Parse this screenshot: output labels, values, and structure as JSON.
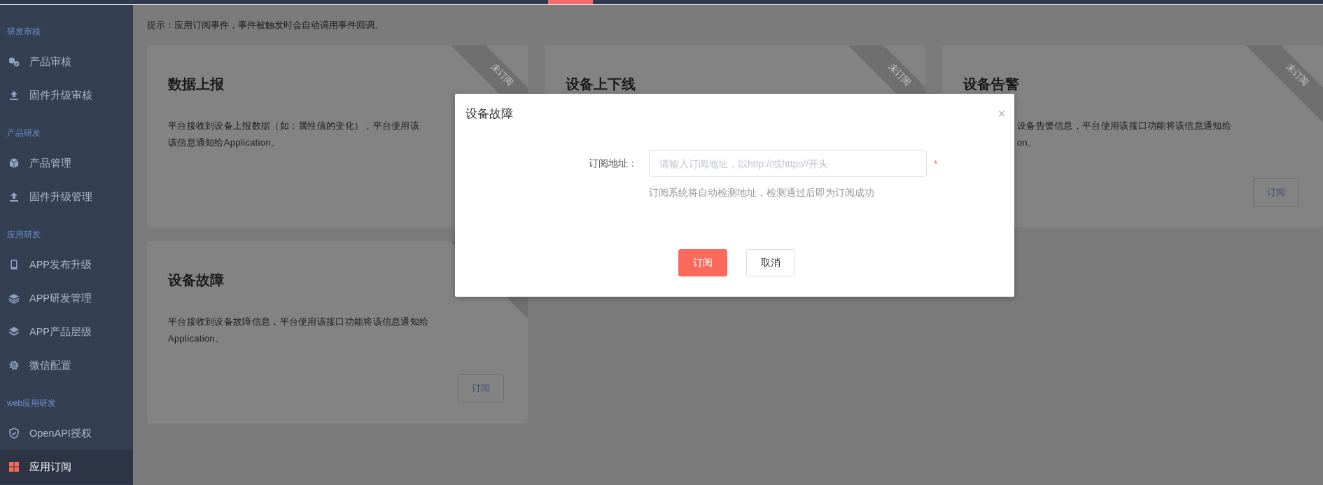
{
  "sidebar": {
    "sections": [
      {
        "label": "研发审核",
        "items": [
          {
            "label": "产品审核",
            "selected": false
          },
          {
            "label": "固件升级审核",
            "selected": false
          }
        ]
      },
      {
        "label": "产品研发",
        "items": [
          {
            "label": "产品管理",
            "selected": false
          },
          {
            "label": "固件升级管理",
            "selected": false
          }
        ]
      },
      {
        "label": "应用研发",
        "items": [
          {
            "label": "APP发布升级",
            "selected": false
          },
          {
            "label": "APP研发管理",
            "selected": false
          },
          {
            "label": "APP产品层级",
            "selected": false
          },
          {
            "label": "微信配置",
            "selected": false
          }
        ]
      },
      {
        "label": "web应用研发",
        "items": [
          {
            "label": "OpenAPI授权",
            "selected": false
          },
          {
            "label": "应用订阅",
            "selected": true
          }
        ]
      }
    ]
  },
  "hint": "提示：应用订阅事件，事件被触发时会自动调用事件回调。",
  "cards": [
    {
      "title": "数据上报",
      "ribbon_label": "未订阅",
      "lines": [
        "平台接收到设备上报数据（如：属性值的变化），平台使用该",
        "该信息通知给Application。"
      ]
    },
    {
      "title": "设备上下线",
      "ribbon_label": "未订阅"
    },
    {
      "title": "设备告警",
      "ribbon_label": "未订阅",
      "clipped_left": true,
      "lines": [
        "设备告警信息，平台使用该接口功能将该信息通知给",
        "on。"
      ],
      "button": "订阅"
    },
    {
      "title": "设备故障",
      "lines": [
        "平台接收到设备故障信息，平台使用该接口功能将该信息通知给",
        "Application。"
      ],
      "button": "订阅"
    }
  ],
  "modal": {
    "title": "设备故障",
    "close": "×",
    "field_label": "订阅地址：",
    "placeholder": "请输入订阅地址，以http://或https//开头",
    "required_mark": "*",
    "field_hint": "订阅系统将自动检测地址，检测通过后即为订阅成功",
    "buttons": [
      {
        "label": "订阅",
        "kind": "primary"
      },
      {
        "label": "取消",
        "kind": "default"
      }
    ]
  }
}
